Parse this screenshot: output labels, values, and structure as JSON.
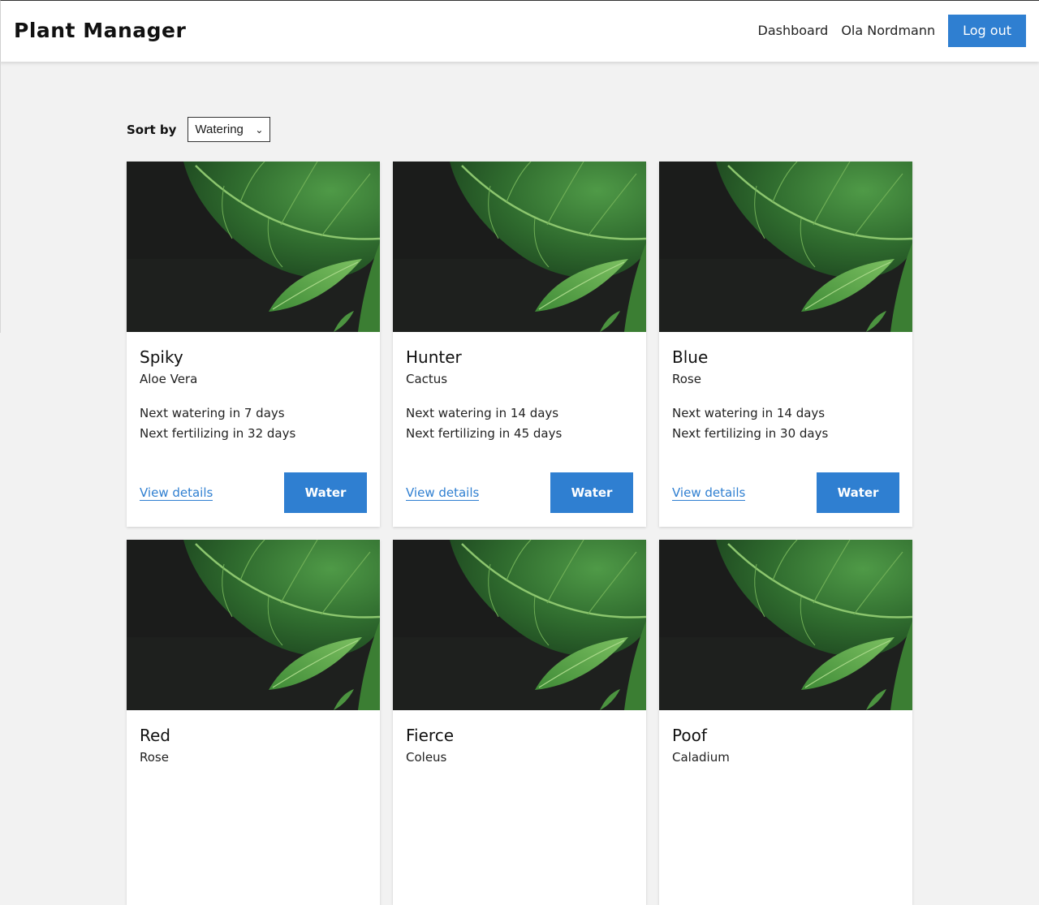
{
  "header": {
    "title": "Plant Manager",
    "nav": {
      "dashboard": "Dashboard",
      "user": "Ola Nordmann",
      "logout": "Log out"
    }
  },
  "sort": {
    "label": "Sort by",
    "selected": "Watering"
  },
  "colors": {
    "accent": "#2f7fd1",
    "background": "#f2f2f2",
    "card": "#ffffff"
  },
  "cards": [
    {
      "name": "Spiky",
      "species": "Aloe Vera",
      "watering": "Next watering in 7 days",
      "fertilizing": "Next fertilizing in 32 days",
      "details": "View details",
      "action": "Water"
    },
    {
      "name": "Hunter",
      "species": "Cactus",
      "watering": "Next watering in 14 days",
      "fertilizing": "Next fertilizing in 45 days",
      "details": "View details",
      "action": "Water"
    },
    {
      "name": "Blue",
      "species": "Rose",
      "watering": "Next watering in 14 days",
      "fertilizing": "Next fertilizing in 30 days",
      "details": "View details",
      "action": "Water"
    },
    {
      "name": "Red",
      "species": "Rose",
      "watering": "",
      "fertilizing": "",
      "details": "",
      "action": ""
    },
    {
      "name": "Fierce",
      "species": "Coleus",
      "watering": "",
      "fertilizing": "",
      "details": "",
      "action": ""
    },
    {
      "name": "Poof",
      "species": "Caladium",
      "watering": "",
      "fertilizing": "",
      "details": "",
      "action": ""
    }
  ]
}
